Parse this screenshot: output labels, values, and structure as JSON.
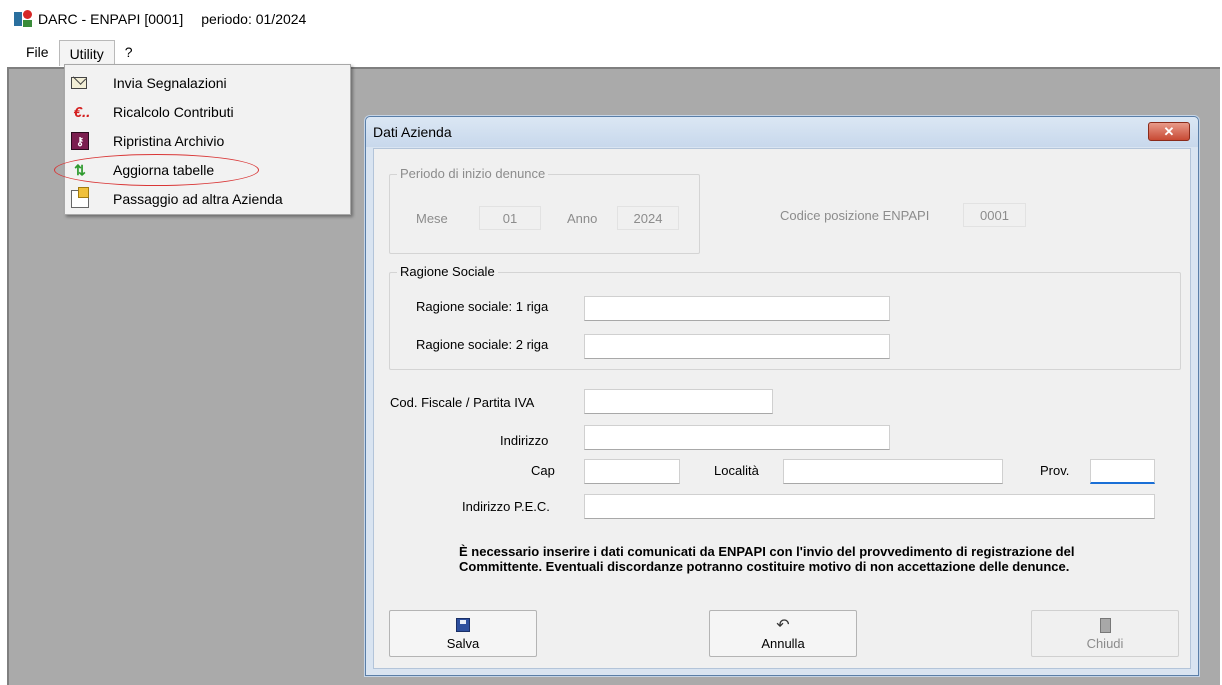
{
  "window": {
    "title": "DARC - ENPAPI  [0001]",
    "period": "periodo: 01/2024"
  },
  "menubar": {
    "items": [
      {
        "label": "File"
      },
      {
        "label": "Utility"
      },
      {
        "label": "?"
      }
    ]
  },
  "utility_menu": {
    "items": [
      {
        "label": "Invia Segnalazioni",
        "icon": "mail-icon"
      },
      {
        "label": "Ricalcolo Contributi",
        "icon": "euro-icon"
      },
      {
        "label": "Ripristina Archivio",
        "icon": "restore-key-icon"
      },
      {
        "label": "Aggiorna tabelle",
        "icon": "refresh-icon",
        "highlighted": true
      },
      {
        "label": "Passaggio ad altra Azienda",
        "icon": "switch-company-icon"
      }
    ]
  },
  "dialog": {
    "title": "Dati Azienda",
    "close_label": "✕",
    "periodo_group": {
      "legend": "Periodo di inizio denunce",
      "mese_label": "Mese",
      "mese_value": "01",
      "anno_label": "Anno",
      "anno_value": "2024"
    },
    "codice_label": "Codice posizione ENPAPI",
    "codice_value": "0001",
    "ragione_group": {
      "legend": "Ragione Sociale",
      "riga1_label": "Ragione sociale: 1 riga",
      "riga1_value": "",
      "riga2_label": "Ragione sociale: 2 riga",
      "riga2_value": ""
    },
    "fields": {
      "cf_label": "Cod. Fiscale / Partita IVA",
      "indirizzo_label": "Indirizzo",
      "cap_label": "Cap",
      "localita_label": "Località",
      "prov_label": "Prov.",
      "pec_label": "Indirizzo P.E.C."
    },
    "notice": "È necessario inserire i dati comunicati da ENPAPI con l'invio del provvedimento di registrazione del Committente. Eventuali discordanze potranno costituire motivo di non accettazione delle denunce.",
    "buttons": {
      "save": "Salva",
      "cancel": "Annulla",
      "close": "Chiudi"
    }
  },
  "colors": {
    "highlight": "#d93636",
    "workspace": "#aaaaaa",
    "dialog_frame": "#d9e4f1",
    "close_button": "#c84a34"
  }
}
